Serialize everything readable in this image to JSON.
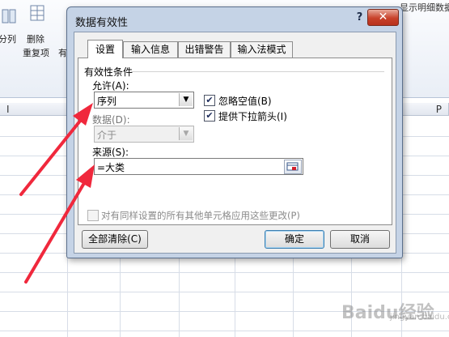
{
  "ribbon": {
    "items": [
      {
        "label": "分列"
      },
      {
        "label": "删除"
      },
      {
        "label": "重复项"
      },
      {
        "label": "有"
      }
    ],
    "right_label": "显示明细数据"
  },
  "sheet": {
    "col_left": "I",
    "col_right": "P"
  },
  "dialog": {
    "title": "数据有效性",
    "help": "?",
    "close": "✕",
    "tabs": [
      {
        "label": "设置",
        "active": true
      },
      {
        "label": "输入信息",
        "active": false
      },
      {
        "label": "出错警告",
        "active": false
      },
      {
        "label": "输入法模式",
        "active": false
      }
    ],
    "group_title": "有效性条件",
    "allow_label": "允许(A):",
    "allow_value": "序列",
    "data_label": "数据(D):",
    "data_value": "介于",
    "ignore_blank_label": "忽略空值(B)",
    "ignore_blank_checked": true,
    "dropdown_label": "提供下拉箭头(I)",
    "dropdown_checked": true,
    "source_label": "来源(S):",
    "source_value": "=大类",
    "apply_all_label": "对有同样设置的所有其他单元格应用这些更改(P)",
    "apply_all_checked": false,
    "clear_all_label": "全部清除(C)",
    "ok_label": "确定",
    "cancel_label": "取消"
  },
  "watermark": {
    "text": "Baidu经验",
    "sub": "jingyan.baidu.com"
  },
  "colors": {
    "arrow": "#f0283c",
    "dialog_frame": "#c5d3e6",
    "close_button": "#c8412a"
  }
}
